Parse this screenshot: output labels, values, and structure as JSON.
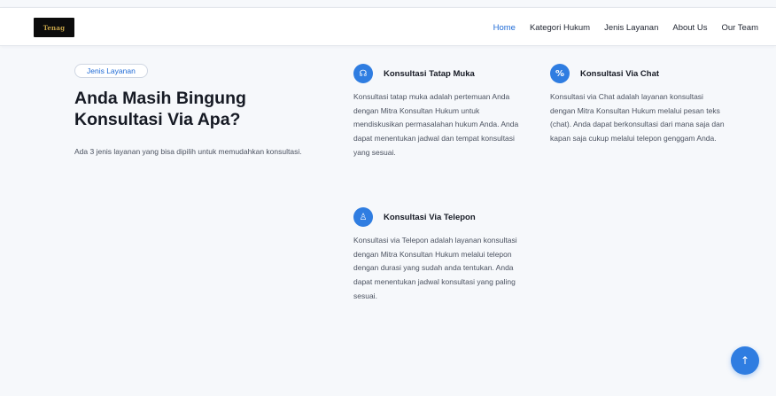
{
  "logo": {
    "text": "Tenag"
  },
  "nav": {
    "items": [
      {
        "label": "Home",
        "active": true
      },
      {
        "label": "Kategori Hukum",
        "active": false
      },
      {
        "label": "Jenis Layanan",
        "active": false
      },
      {
        "label": "About Us",
        "active": false
      },
      {
        "label": "Our Team",
        "active": false
      }
    ]
  },
  "section": {
    "pill_label": "Jenis Layanan",
    "title_line1": "Anda Masih Bingung",
    "title_line2": "Konsultasi Via Apa?",
    "intro": "Ada 3 jenis layanan yang bisa dipilih untuk memudahkan konsultasi."
  },
  "services": [
    {
      "icon": "handshake-icon",
      "glyph": "☊",
      "title": "Konsultasi Tatap Muka",
      "description": "Konsultasi tatap muka adalah pertemuan Anda dengan Mitra Konsultan Hukum untuk mendiskusikan permasalahan hukum Anda. Anda dapat menentukan jadwal dan tempat konsultasi yang sesuai."
    },
    {
      "icon": "percent-icon",
      "glyph": "%",
      "title": "Konsultasi Via Chat",
      "description": "Konsultasi via Chat adalah layanan konsultasi dengan Mitra Konsultan Hukum melalui pesan teks (chat). Anda dapat berkonsultasi dari mana saja dan kapan saja cukup melalui telepon genggam Anda."
    },
    {
      "icon": "badge-icon",
      "glyph": "♙",
      "title": "Konsultasi Via Telepon",
      "description": "Konsultasi via Telepon adalah layanan konsultasi dengan Mitra Konsultan Hukum melalui telepon dengan durasi yang sudah anda tentukan. Anda dapat menentukan jadwal konsultasi yang paling sesuai."
    }
  ],
  "scroll_top": {
    "glyph": "↑"
  },
  "colors": {
    "accent": "#2f7de1",
    "nav_active": "#1e6ad6",
    "background": "#f6f8fb",
    "heading": "#161a24"
  }
}
